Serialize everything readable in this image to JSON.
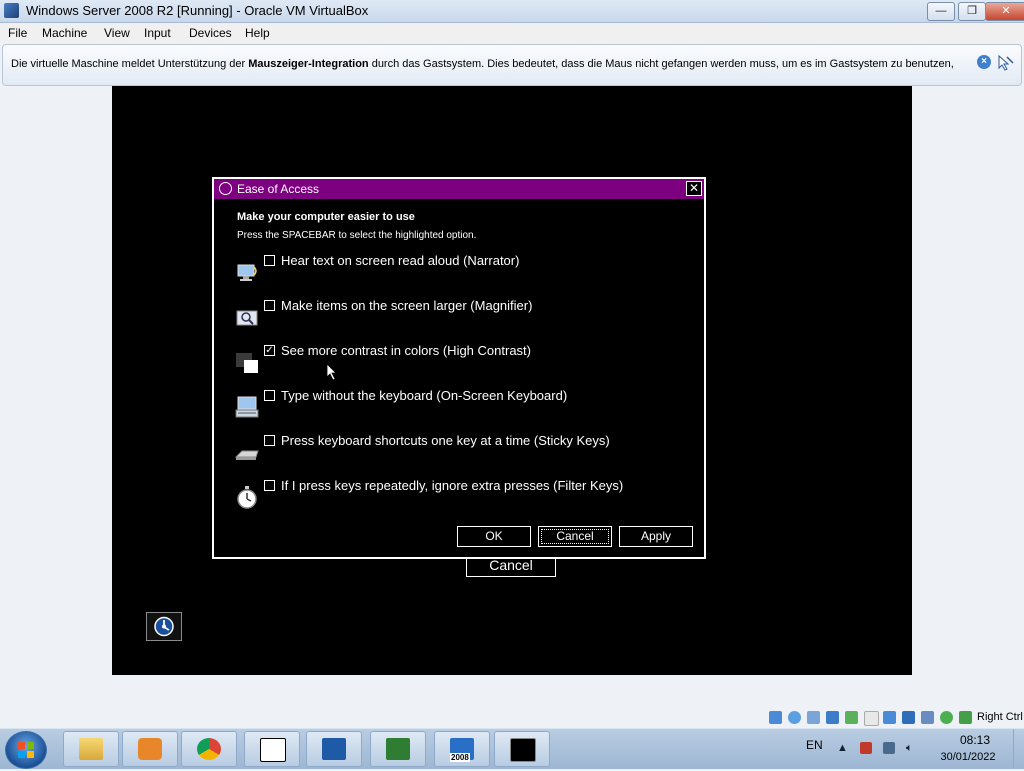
{
  "host_window": {
    "title": "Windows Server 2008 R2 [Running] - Oracle VM VirtualBox",
    "minimize_label": "—",
    "maximize_label": "❐",
    "close_label": "✕"
  },
  "menu": [
    "File",
    "Machine",
    "View",
    "Input",
    "Devices",
    "Help"
  ],
  "notice": {
    "text_before": "Die virtuelle Maschine meldet Unterstützung der ",
    "text_bold": "Mauszeiger-Integration",
    "text_after": " durch das Gastsystem. Dies bedeutet, dass die Maus nicht gefangen werden muss, um es im Gastsystem zu benutzen,",
    "close_glyph": "×"
  },
  "guest": {
    "background_cancel_label": "Cancel"
  },
  "dialog": {
    "title": "Ease of Access",
    "close_glyph": "✕",
    "heading": "Make your computer easier to use",
    "instruction": "Press the SPACEBAR to select the highlighted option.",
    "options": [
      {
        "label": "Hear text on screen read aloud (Narrator)",
        "checked": false,
        "icon": "narrator-icon"
      },
      {
        "label": "Make items on the screen larger (Magnifier)",
        "checked": false,
        "icon": "magnifier-icon"
      },
      {
        "label": "See more contrast in colors (High Contrast)",
        "checked": true,
        "icon": "high-contrast-icon"
      },
      {
        "label": "Type without the keyboard (On-Screen Keyboard)",
        "checked": false,
        "icon": "on-screen-keyboard-icon"
      },
      {
        "label": "Press keyboard shortcuts one key at a time (Sticky Keys)",
        "checked": false,
        "icon": "sticky-keys-icon"
      },
      {
        "label": "If I press keys repeatedly, ignore extra presses (Filter Keys)",
        "checked": false,
        "icon": "filter-keys-icon"
      }
    ],
    "check_glyph": "✓",
    "buttons": {
      "ok": "OK",
      "cancel": "Cancel",
      "apply": "Apply"
    }
  },
  "statusbar": {
    "host_key": "Right Ctrl"
  },
  "taskbar": {
    "apps": [
      "file-explorer",
      "media-player",
      "chrome",
      "7zip",
      "virtualbox",
      "system-monitor",
      "windows-server-2008",
      "command-prompt"
    ],
    "badge_2008": "2008",
    "language": "EN",
    "time": "08:13",
    "date": "30/01/2022"
  }
}
